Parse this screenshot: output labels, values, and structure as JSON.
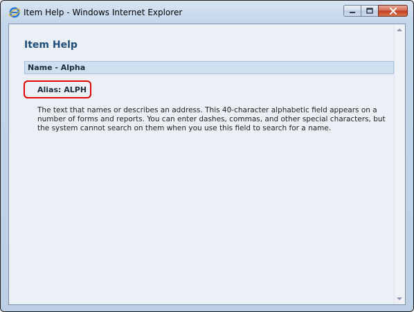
{
  "window": {
    "title": "Item Help - Windows Internet Explorer",
    "icons": {
      "app": "internet-explorer-icon",
      "minimize": "minimize-icon",
      "maximize": "maximize-icon",
      "close": "close-icon"
    }
  },
  "help": {
    "heading": "Item Help",
    "section_title": "Name - Alpha",
    "alias": "Alias: ALPH",
    "description": "The text that names or describes an address. This 40-character alphabetic field appears on a number of forms and reports. You can enter dashes, commas, and other special characters, but the system cannot search on them when you use this field to search for a name."
  },
  "colors": {
    "heading": "#1e4e79",
    "highlight_box": "#e00000",
    "section_bar": "#cfdff0"
  }
}
